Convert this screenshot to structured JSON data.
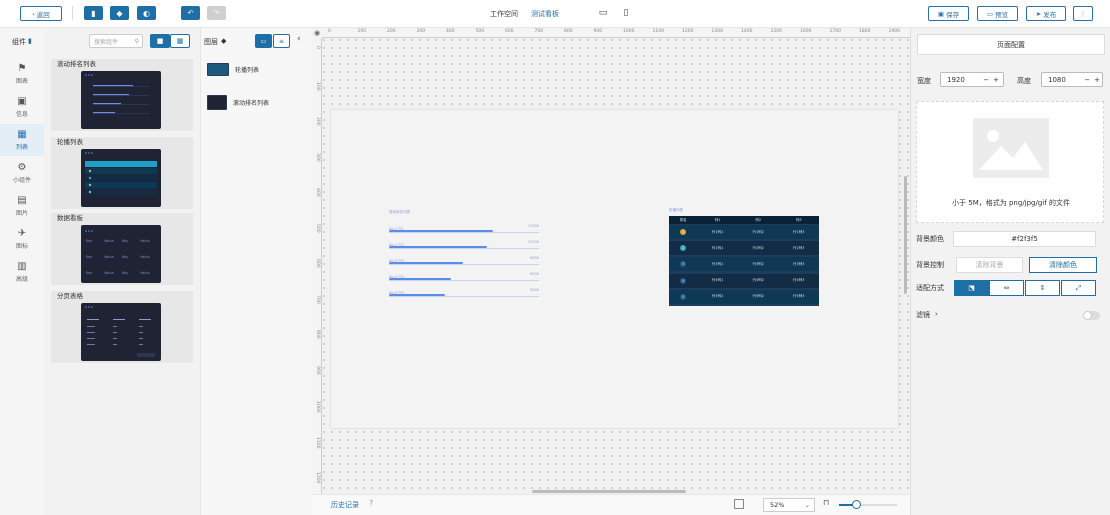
{
  "toolbar": {
    "back_label": "返回",
    "workspace_label": "工作空间",
    "dashboard_name": "测试看板",
    "save_label": "保存",
    "preview_label": "预览",
    "publish_label": "发布",
    "more_label": "⋮"
  },
  "components_panel": {
    "title": "组件",
    "search_placeholder": "搜索组件",
    "categories": [
      {
        "label": "图表",
        "icon": "chart-icon"
      },
      {
        "label": "信息",
        "icon": "info-icon"
      },
      {
        "label": "列表",
        "icon": "list-icon"
      },
      {
        "label": "小组件",
        "icon": "widget-icon"
      },
      {
        "label": "图片",
        "icon": "image-icon"
      },
      {
        "label": "图标",
        "icon": "plane-icon"
      },
      {
        "label": "高级",
        "icon": "advanced-icon"
      }
    ],
    "cards": [
      {
        "title": "滚动排名列表"
      },
      {
        "title": "轮播列表"
      },
      {
        "title": "数据看板"
      },
      {
        "title": "分页表格"
      }
    ],
    "dashboard_thumb_cells": [
      "Key",
      "Value",
      "Key",
      "Value",
      "Key",
      "Value",
      "Key",
      "Value",
      "Key",
      "Value",
      "Key",
      "Value"
    ]
  },
  "layers_panel": {
    "title": "图层",
    "items": [
      {
        "label": "轮播列表"
      },
      {
        "label": "滚动排名列表"
      }
    ]
  },
  "canvas": {
    "ruler_h_labels": [
      "0",
      "100",
      "200",
      "300",
      "400",
      "500",
      "600",
      "700",
      "800",
      "900",
      "1000",
      "1100",
      "1200",
      "1300",
      "1400",
      "1500",
      "1600",
      "1700",
      "1800",
      "1900"
    ],
    "ruler_v_labels": [
      "0",
      "100",
      "200",
      "300",
      "400",
      "500",
      "600",
      "700",
      "800",
      "900",
      "1000",
      "1100",
      "1200"
    ],
    "rank_title": "滚动排名列表",
    "rank_rows": [
      {
        "label": "No.1 行1",
        "value": "11000",
        "fraction": 0.69
      },
      {
        "label": "No.2 行2",
        "value": "10700",
        "fraction": 0.65
      },
      {
        "label": "No.3 行3",
        "value": "8000",
        "fraction": 0.49
      },
      {
        "label": "No.4 行4",
        "value": "6000",
        "fraction": 0.41
      },
      {
        "label": "No.5 行5",
        "value": "5000",
        "fraction": 0.37
      }
    ],
    "carousel_title": "轮播列表",
    "table_header": [
      "排名",
      "列1",
      "列2",
      "列3"
    ],
    "table_rows": [
      {
        "rank": "1",
        "c1": "行1列1",
        "c2": "行1列2",
        "c3": "行1列3",
        "color": "#e8a23b"
      },
      {
        "rank": "2",
        "c1": "行2列1",
        "c2": "行2列2",
        "c3": "行2列3",
        "color": "#3ea6b8"
      },
      {
        "rank": "3",
        "c1": "行3列1",
        "c2": "行3列2",
        "c3": "行3列3",
        "color": "#2b5c86"
      },
      {
        "rank": "4",
        "c1": "行4列1",
        "c2": "行4列2",
        "c3": "行4列3",
        "color": "#2b5c86"
      },
      {
        "rank": "5",
        "c1": "行5列1",
        "c2": "行5列2",
        "c3": "行5列3",
        "color": "#2b5c86"
      }
    ]
  },
  "bottom": {
    "history_label": "历史记录",
    "zoom_value": "52%"
  },
  "right_panel": {
    "tab_label": "页面配置",
    "width_label": "宽度",
    "width_value": "1920",
    "height_label": "高度",
    "height_value": "1080",
    "upload_hint": "小于 5M，格式为 png/jpg/gif 的文件",
    "bg_color_label": "背景颜色",
    "bg_color_value": "#f2f3f5",
    "bg_control_label": "背景控制",
    "clear_bg_label": "清除背景",
    "clear_color_label": "清除颜色",
    "fit_label": "适配方式",
    "filter_label": "滤镜"
  },
  "colors": {
    "accent": "#1d6fa5",
    "dark_panel": "#1d3d5d"
  }
}
